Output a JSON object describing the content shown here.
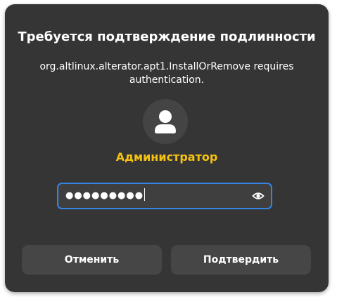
{
  "dialog": {
    "title": "Требуется подтверждение подлинности",
    "message": "org.altlinux.alterator.apt1.InstallOrRemove requires authentication.",
    "avatar_icon": "user-avatar-icon",
    "username": "Администратор",
    "password": {
      "value": "●●●●●●●●●",
      "reveal_icon": "eye-icon"
    },
    "buttons": {
      "cancel_label": "Отменить",
      "confirm_label": "Подтвердить"
    }
  },
  "colors": {
    "dialog_bg": "#353535",
    "accent_username": "#f5c211",
    "focus_border": "#3584e4",
    "button_bg": "#464646"
  }
}
